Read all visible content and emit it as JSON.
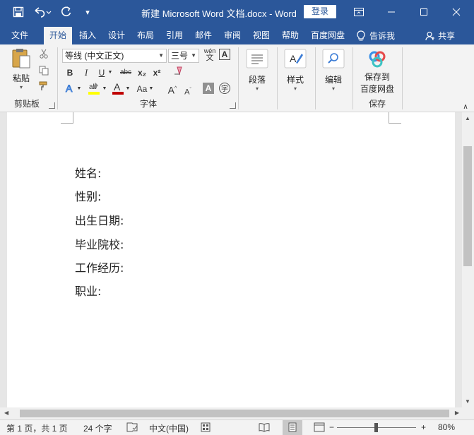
{
  "window": {
    "title": "新建 Microsoft Word 文档.docx  -  Word",
    "login_label": "登录",
    "controls": [
      "ribbon-display-options",
      "minimize",
      "maximize",
      "close"
    ]
  },
  "qat": {
    "save": "save-icon",
    "undo": "undo-icon",
    "redo": "redo-icon",
    "customize": "▾"
  },
  "tabs": [
    {
      "label": "文件"
    },
    {
      "label": "开始"
    },
    {
      "label": "插入"
    },
    {
      "label": "设计"
    },
    {
      "label": "布局"
    },
    {
      "label": "引用"
    },
    {
      "label": "邮件"
    },
    {
      "label": "审阅"
    },
    {
      "label": "视图"
    },
    {
      "label": "帮助"
    },
    {
      "label": "百度网盘"
    }
  ],
  "active_tab": "开始",
  "tellme_label": "告诉我",
  "share_label": "共享",
  "ribbon": {
    "clipboard": {
      "paste_label": "粘贴",
      "group_label": "剪贴板"
    },
    "font": {
      "font_name": "等线 (中文正文)",
      "font_size": "三号",
      "bold": "B",
      "italic": "I",
      "underline": "U",
      "strike": "abc",
      "subscript": "x₂",
      "superscript": "x²",
      "grow": "A",
      "shrink": "A",
      "change_case": "Aa",
      "phonetic_top": "wén",
      "phonetic_bottom": "文",
      "group_label": "字体"
    },
    "paragraph": {
      "label": "段落"
    },
    "styles": {
      "label": "样式"
    },
    "editing": {
      "label": "编辑"
    },
    "save": {
      "label_line1": "保存到",
      "label_line2": "百度网盘",
      "group_label": "保存"
    }
  },
  "document": {
    "lines": [
      "姓名:",
      "性别:",
      "出生日期:",
      "毕业院校:",
      "工作经历:",
      "职业:"
    ]
  },
  "status": {
    "page": "第 1 页，共 1 页",
    "words": "24 个字",
    "language": "中文(中国)",
    "zoom": "80%",
    "zoom_level": 0.8
  },
  "colors": {
    "accent": "#2b579a",
    "highlight": "#ffff00",
    "font_color": "#c00000"
  }
}
